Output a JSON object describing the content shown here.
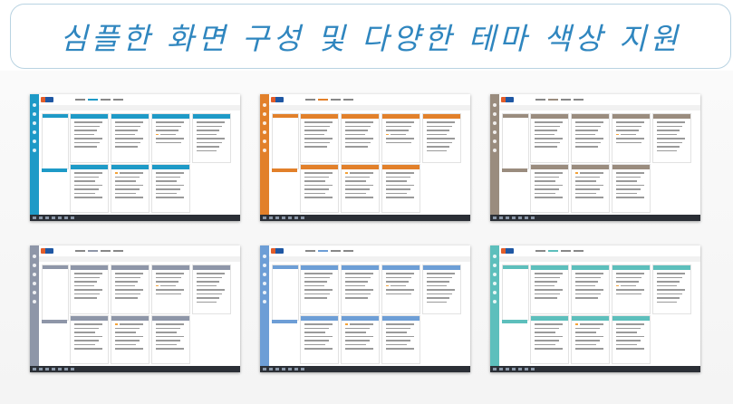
{
  "headline": "심플한 화면 구성 및 다양한 테마 색상 지원",
  "colors": {
    "headline_text": "#2f86bf",
    "headline_border": "#b9d3e2"
  },
  "themes": [
    {
      "name": "blue",
      "accent": "#1e9ac7",
      "sidebar": "#1e9ac7",
      "active_tab": "#2a7fc1"
    },
    {
      "name": "orange",
      "accent": "#e2802a",
      "sidebar": "#e2802a",
      "active_tab": "#e2802a"
    },
    {
      "name": "brown",
      "accent": "#9a8c7e",
      "sidebar": "#9a8c7e",
      "active_tab": "#9a8c7e"
    },
    {
      "name": "gray",
      "accent": "#8e96a8",
      "sidebar": "#8e96a8",
      "active_tab": "#8e96a8"
    },
    {
      "name": "sky",
      "accent": "#6d9ed6",
      "sidebar": "#6d9ed6",
      "active_tab": "#6d9ed6"
    },
    {
      "name": "teal",
      "accent": "#5dbfbc",
      "sidebar": "#5dbfbc",
      "active_tab": "#5dbfbc"
    }
  ]
}
